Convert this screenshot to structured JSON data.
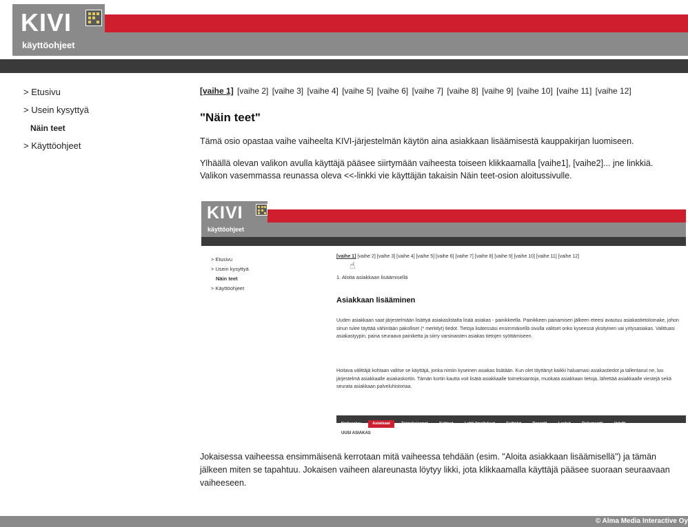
{
  "header": {
    "logo_title": "KIVI",
    "logo_subtitle": "käyttöohjeet",
    "colors": {
      "red": "#cf1f2e",
      "grey": "#8a8a8a",
      "dark": "#3a3a3a"
    }
  },
  "sidebar": {
    "items": [
      {
        "label": "> Etusivu"
      },
      {
        "label": "> Usein kysyttyä"
      },
      {
        "label": "Näin teet"
      },
      {
        "label": "> Käyttöohjeet"
      }
    ]
  },
  "steps": [
    "[vaihe 1]",
    "[vaihe 2]",
    "[vaihe 3]",
    "[vaihe 4]",
    "[vaihe 5]",
    "[vaihe 6]",
    "[vaihe 7]",
    "[vaihe 8]",
    "[vaihe 9]",
    "[vaihe 10]",
    "[vaihe 11]",
    "[vaihe 12]"
  ],
  "main": {
    "title": "\"Näin teet\"",
    "intro": "Tämä osio opastaa vaihe vaiheelta KIVI-järjestelmän käytön aina asiakkaan lisäämisestä kauppakirjan luomiseen.",
    "nav_help": "Ylhäällä olevan valikon avulla käyttäjä pääsee siirtymään vaiheesta toiseen klikkaamalla [vaihe1], [vaihe2]... jne linkkiä. Valikon vasemmassa reunassa oleva <<-linkki vie käyttäjän takaisin Näin teet-osion aloitussivulle.",
    "outro": "Jokaisessa vaiheessa ensimmäisenä kerrotaan mitä vaiheessa tehdään (esim. \"Aloita asiakkaan lisäämisellä\") ja tämän jälkeen miten se tapahtuu. Jokaisen vaiheen alareunasta löytyy likki, jota klikkaamalla käyttäjä pääsee suoraan seuraavaan vaiheeseen."
  },
  "screenshot": {
    "logo_title": "KIVI",
    "logo_subtitle": "käyttöohjeet",
    "sidebar": [
      "> Etusivu",
      "> Usein kysyttyä",
      "Näin teet",
      "> Käyttöohjeet"
    ],
    "steps_text": "[vaihe 2] [vaihe 3] [vaihe 4] [vaihe 5] [vaihe 6] [vaihe 7] [vaihe 8] [vaihe 9] [vaihe 10] [vaihe 11] [vaihe 12]",
    "active_step": "[vaihe 1]",
    "step_heading": "1. Aloita asiakkaan lisäämisellä",
    "section_title": "Asiakkaan lisääminen",
    "para1": "Uuden asiakkaan saat järjestelmään lisättyä asiakaslistalta lisää asiakas - painikkeella. Painikkeen painamisen jälkeen eteesi avautuu asiakastietolomake, johon sinun tulee täyttää vähintään pakolliset (* merkityt) tiedot. Tietoja lisätessäsi ensimmäisellä sivulla valitset onko kyseessä yksityinen vai yritysasiakas. Valittuasi asiakastyypin, paina seuraava painiketta ja siirry varsinaisten asiakas tietojen syöttämiseen.",
    "para2": "Hoitava välittäjä kohtaan valitse se käyttäjä, jonka nimiin kyseinen asiakas lisätään. Kun olet täyttänyt kaikki haluamasi asiakastiedot ja tallentanut ne, luo järjestelmä asiakkaalle asiakaskortin. Tämän kortin kautta voit lisätä asiakkaalle toimeksiantoja, muokata asiakkaan tietoja, lähettää asiakkaalle viestejä sekä seurata asiakkaan palveluhistoriaa.",
    "nav": [
      "Aloitussivu",
      "Asiakkaat",
      "Toimeksiannot",
      "Kohteet",
      "Lehti-ilmoitukset",
      "Esittelyt",
      "Raportit",
      "Laskut",
      "Dokumentit",
      "Vahdit"
    ],
    "nav_active": "Asiakkaat",
    "new_client": "UUSI ASIAKAS"
  },
  "footer": {
    "copyright": "© Alma Media Interactive Oy"
  }
}
